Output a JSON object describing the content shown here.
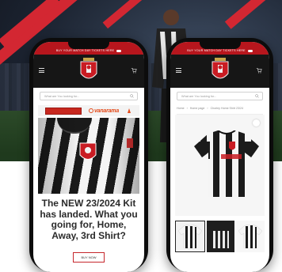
{
  "backdrop": {
    "accent_red": "#d32732",
    "sky": "#1d2533",
    "pitch": "#203a20"
  },
  "left_phone": {
    "promo_banner": "BUY YOUR MATCH DAY TICKETS HERE",
    "search_placeholder": "What are You looking for...",
    "sponsor_primary": "",
    "sponsor_secondary": "vanarama",
    "headline": "The NEW 23/2024 Kit has landed. What you going for, Home, Away, 3rd Shirt?",
    "buy_button": "BUY NOW",
    "colors": {
      "header": "#161616",
      "promo": "#b7161d",
      "button_border": "#c6262c"
    }
  },
  "right_phone": {
    "promo_banner": "BUY YOUR MATCH DAY TICKETS HERE",
    "search_placeholder": "What are You looking for...",
    "breadcrumb": [
      "Home",
      "Home page",
      "Chorley Home Shirt 23/24"
    ],
    "breadcrumb_sep": "›",
    "thumbnails": [
      "front",
      "photo",
      "back"
    ],
    "colors": {
      "header": "#161616",
      "promo": "#b7161d"
    }
  },
  "icons": [
    "menu-icon",
    "cart-icon",
    "search-icon",
    "zoom-icon",
    "crest-icon"
  ]
}
